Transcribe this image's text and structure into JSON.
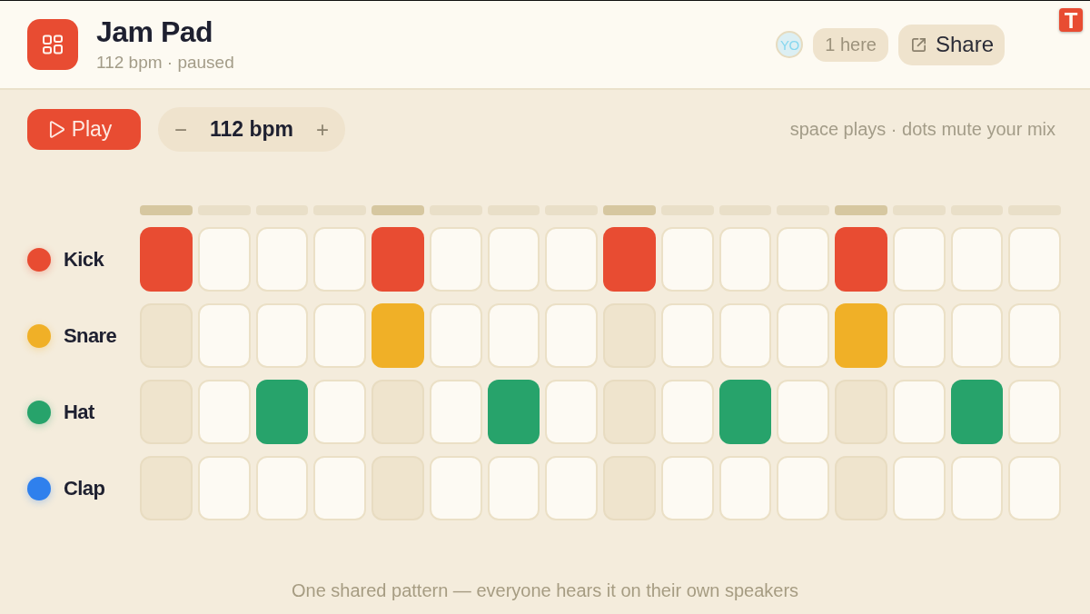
{
  "header": {
    "title": "Jam Pad",
    "subtitle": "112 bpm · paused",
    "presence": {
      "avatar": "YO",
      "count": "1 here"
    },
    "share_button": "Share",
    "corner_badge": "T"
  },
  "toolbar": {
    "play_button": "Play",
    "tempo": {
      "decrement": "−",
      "value": "112 bpm",
      "increment": "+"
    },
    "hint": "space plays · dots mute your mix"
  },
  "beats": [
    {
      "downbeat": true
    },
    {
      "downbeat": false
    },
    {
      "downbeat": false
    },
    {
      "downbeat": false
    },
    {
      "downbeat": true
    },
    {
      "downbeat": false
    },
    {
      "downbeat": false
    },
    {
      "downbeat": false
    },
    {
      "downbeat": true
    },
    {
      "downbeat": false
    },
    {
      "downbeat": false
    },
    {
      "downbeat": false
    },
    {
      "downbeat": true
    },
    {
      "downbeat": false
    },
    {
      "downbeat": false
    },
    {
      "downbeat": false
    }
  ],
  "tracks": [
    {
      "name": "Kick",
      "color": "#e84c32",
      "steps": [
        {
          "on": true
        },
        {
          "on": false
        },
        {
          "on": false
        },
        {
          "on": false
        },
        {
          "on": true
        },
        {
          "on": false
        },
        {
          "on": false
        },
        {
          "on": false
        },
        {
          "on": true
        },
        {
          "on": false
        },
        {
          "on": false
        },
        {
          "on": false
        },
        {
          "on": true
        },
        {
          "on": false
        },
        {
          "on": false
        },
        {
          "on": false
        }
      ]
    },
    {
      "name": "Snare",
      "color": "#f0b027",
      "steps": [
        {
          "on": false
        },
        {
          "on": false
        },
        {
          "on": false
        },
        {
          "on": false
        },
        {
          "on": true
        },
        {
          "on": false
        },
        {
          "on": false
        },
        {
          "on": false
        },
        {
          "on": false
        },
        {
          "on": false
        },
        {
          "on": false
        },
        {
          "on": false
        },
        {
          "on": true
        },
        {
          "on": false
        },
        {
          "on": false
        },
        {
          "on": false
        }
      ]
    },
    {
      "name": "Hat",
      "color": "#27a36b",
      "steps": [
        {
          "on": false
        },
        {
          "on": false
        },
        {
          "on": true
        },
        {
          "on": false
        },
        {
          "on": false
        },
        {
          "on": false
        },
        {
          "on": true
        },
        {
          "on": false
        },
        {
          "on": false
        },
        {
          "on": false
        },
        {
          "on": true
        },
        {
          "on": false
        },
        {
          "on": false
        },
        {
          "on": false
        },
        {
          "on": true
        },
        {
          "on": false
        }
      ]
    },
    {
      "name": "Clap",
      "color": "#2f80ed",
      "steps": [
        {
          "on": false
        },
        {
          "on": false
        },
        {
          "on": false
        },
        {
          "on": false
        },
        {
          "on": false
        },
        {
          "on": false
        },
        {
          "on": false
        },
        {
          "on": false
        },
        {
          "on": false
        },
        {
          "on": false
        },
        {
          "on": false
        },
        {
          "on": false
        },
        {
          "on": false
        },
        {
          "on": false
        },
        {
          "on": false
        },
        {
          "on": false
        }
      ]
    }
  ],
  "footer": "One shared pattern — everyone hears it on their own speakers"
}
